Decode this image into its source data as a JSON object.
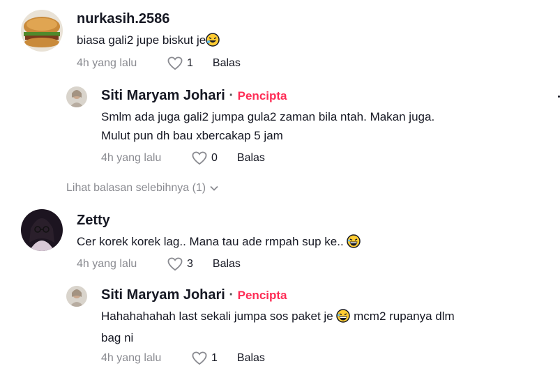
{
  "comments": [
    {
      "username": "nurkasih.2586",
      "text": "biasa gali2 jupe biskut je",
      "time": "4h yang lalu",
      "likes": "1",
      "reply_label": "Balas",
      "avatar_icon": "burger-avatar",
      "emoji_icon": "laughing-face-icon",
      "replies": [
        {
          "username": "Siti Maryam Johari",
          "separator": "·",
          "badge": "Pencipta",
          "text_line1": "Smlm ada juga gali2 jumpa gula2 zaman bila ntah. Makan juga.",
          "text_line2": "Mulut pun dh bau xbercakap 5 jam",
          "time": "4h yang lalu",
          "likes": "0",
          "reply_label": "Balas"
        }
      ],
      "more_replies": "Lihat balasan selebihnya (1)"
    },
    {
      "username": "Zetty",
      "text": "Cer korek korek lag.. Mana tau ade rmpah sup ke..",
      "time": "4h yang lalu",
      "likes": "3",
      "reply_label": "Balas",
      "avatar_icon": "woman-avatar",
      "emoji_icon": "grinning-face-icon",
      "replies": [
        {
          "username": "Siti Maryam Johari",
          "separator": "·",
          "badge": "Pencipta",
          "text_line1a": "Hahahahahah last sekali jumpa sos paket je",
          "text_line1b": "mcm2 rupanya dlm",
          "text_line2": "bag ni",
          "time": "4h yang lalu",
          "likes": "1",
          "reply_label": "Balas"
        }
      ]
    }
  ],
  "colors": {
    "creator": "#fe2c55",
    "muted": "#8a8b91",
    "text": "#161823"
  }
}
